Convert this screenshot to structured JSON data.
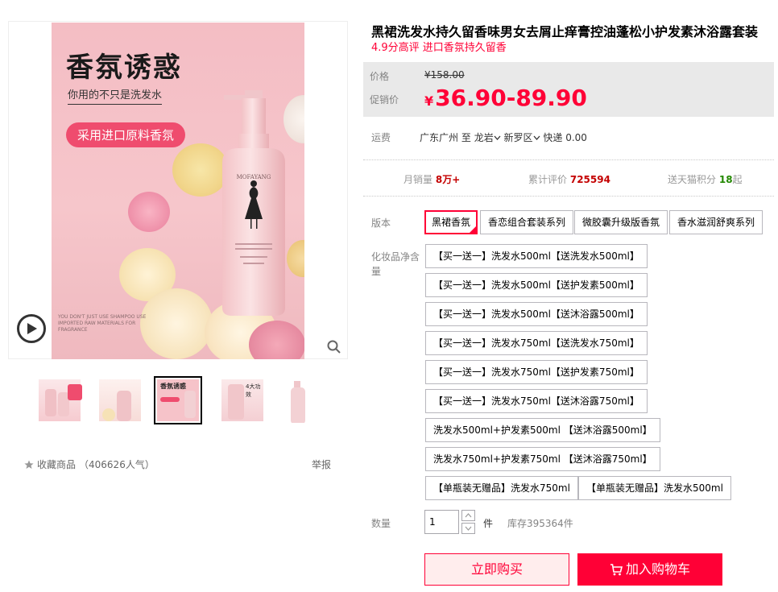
{
  "product": {
    "title": "黑裙洗发水持久留香味男女去屑止痒膏控油蓬松小护发素沐浴露套装",
    "subtitle": "4.9分高评 进口香氛持久留香"
  },
  "gallery": {
    "headline": "香氛诱惑",
    "sub": "你用的不只是洗发水",
    "pill": "采用进口原料香氛",
    "small_text": "YOU DON'T JUST USE SHAMPOO USE IMPORTED RAW MATERIALS FOR FRAGRANCE",
    "brand": "MOFAYANG",
    "thumb3_text": "香氛诱惑",
    "thumb4_text": "4大功效",
    "fav_label": "收藏商品",
    "fav_count": "（406626人气）",
    "report_label": "举报"
  },
  "price": {
    "orig_label": "价格",
    "orig_value": "¥158.00",
    "promo_label": "促销价",
    "currency": "¥",
    "promo_value": "36.90-89.90"
  },
  "shipping": {
    "label": "运费",
    "from": "广东广州",
    "to_word": "至",
    "city": "龙岩",
    "district": "新罗区",
    "method": "快递 0.00"
  },
  "stats": {
    "monthly_label": "月销量",
    "monthly_value": "8万+",
    "reviews_label": "累计评价",
    "reviews_value": "725594",
    "points_label": "送天猫积分",
    "points_value": "18",
    "points_suffix": "起"
  },
  "version": {
    "label": "版本",
    "options": [
      "黑裙香氛",
      "香恋组合套装系列",
      "微胶囊升级版香氛",
      "香水滋润舒爽系列"
    ],
    "selected": "黑裙香氛"
  },
  "volume": {
    "label": "化妆品净含量",
    "options": [
      "【买一送一】洗发水500ml【送洗发水500ml】",
      "【买一送一】洗发水500ml【送护发素500ml】",
      "【买一送一】洗发水500ml【送沐浴露500ml】",
      "【买一送一】洗发水750ml【送洗发水750ml】",
      "【买一送一】洗发水750ml【送护发素750ml】",
      "【买一送一】洗发水750ml【送沐浴露750ml】",
      "洗发水500ml+护发素500ml 【送沐浴露500ml】",
      "洗发水750ml+护发素750ml 【送沐浴露750ml】",
      "【单瓶装无赠品】洗发水750ml",
      "【单瓶装无赠品】洗发水500ml"
    ]
  },
  "quantity": {
    "label": "数量",
    "value": "1",
    "unit": "件",
    "stock": "库存395364件"
  },
  "actions": {
    "buy_now": "立即购买",
    "add_cart": "加入购物车"
  },
  "colors": {
    "accent": "#ff0036",
    "price_box": "#e9e9e9"
  }
}
